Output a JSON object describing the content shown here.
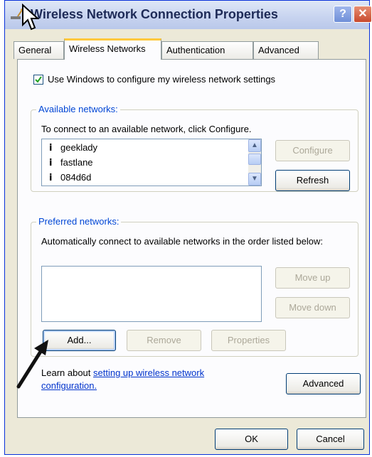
{
  "window": {
    "title": "Wireless Network Connection Properties",
    "help_label": "?",
    "close_label": "✕"
  },
  "tabs": [
    {
      "label": "General",
      "active": false
    },
    {
      "label": "Wireless Networks",
      "active": true
    },
    {
      "label": "Authentication",
      "active": false
    },
    {
      "label": "Advanced",
      "active": false
    }
  ],
  "use_windows_checkbox": {
    "label": "Use Windows to configure my wireless network settings",
    "checked": true
  },
  "available_networks": {
    "legend": "Available networks:",
    "description": "To connect to an available network, click Configure.",
    "networks": [
      "geeklady",
      "fastlane",
      "084d6d"
    ],
    "configure_label": "Configure",
    "refresh_label": "Refresh"
  },
  "preferred_networks": {
    "legend": "Preferred networks:",
    "description": "Automatically connect to available networks in the order listed below:",
    "move_up_label": "Move up",
    "move_down_label": "Move down",
    "add_label": "Add...",
    "remove_label": "Remove",
    "properties_label": "Properties"
  },
  "learn_about": {
    "prefix": "Learn about ",
    "link_text_1": "setting up wireless network",
    "link_text_2": "configuration."
  },
  "advanced_button_label": "Advanced",
  "footer": {
    "ok_label": "OK",
    "cancel_label": "Cancel"
  },
  "colors": {
    "accent_tab": "#ffc83c",
    "legend_blue": "#0046d5",
    "link_blue": "#0033cc"
  }
}
